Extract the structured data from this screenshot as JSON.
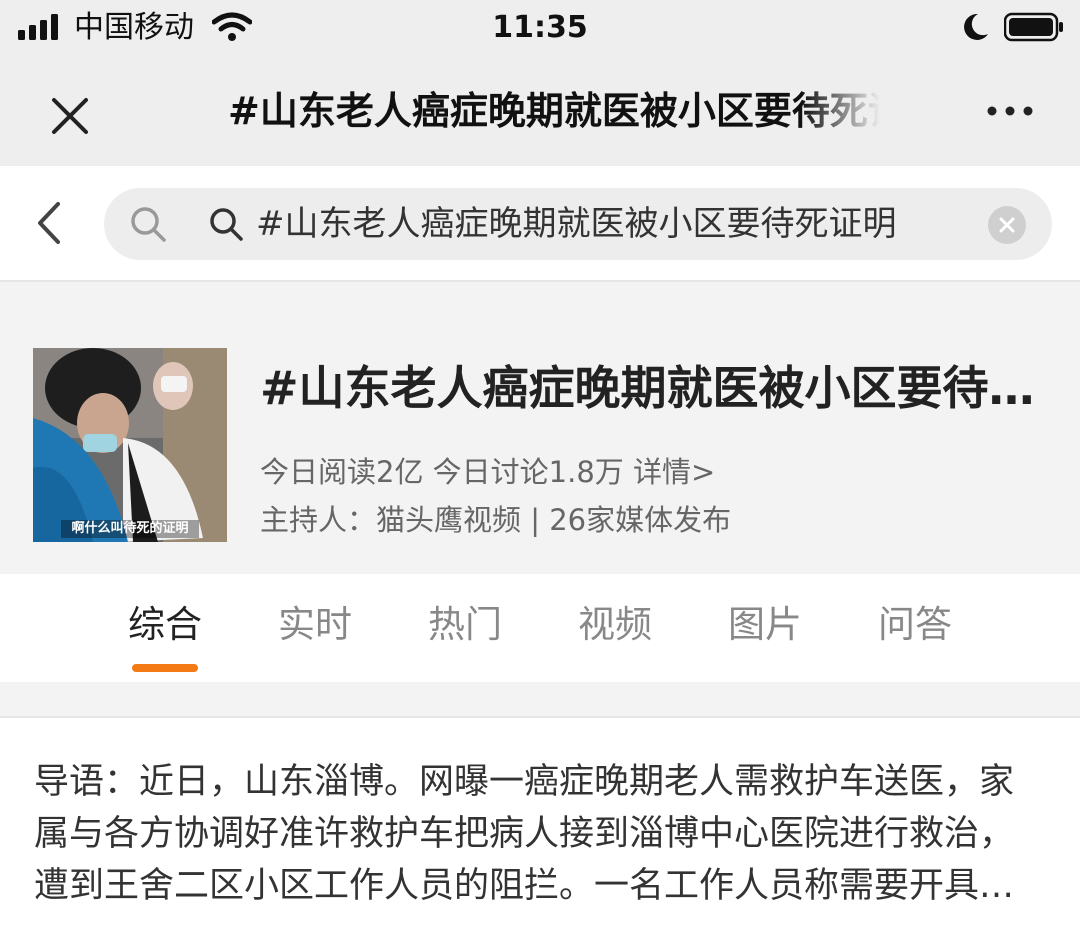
{
  "status_bar": {
    "carrier": "中国移动",
    "time": "11:35"
  },
  "title_bar": {
    "title": "#山东老人癌症晚期就医被小区要待死证明"
  },
  "search": {
    "query": "#山东老人癌症晚期就医被小区要待死证明"
  },
  "topic": {
    "title": "#山东老人癌症晚期就医被小区要待死证明#",
    "thumbnail_caption": "啊什么叫待死的证明",
    "stats": "今日阅读2亿 今日讨论1.8万 详情>",
    "host": "主持人：猫头鹰视频 | 26家媒体发布"
  },
  "tabs": [
    {
      "label": "综合",
      "active": true
    },
    {
      "label": "实时",
      "active": false
    },
    {
      "label": "热门",
      "active": false
    },
    {
      "label": "视频",
      "active": false
    },
    {
      "label": "图片",
      "active": false
    },
    {
      "label": "问答",
      "active": false
    }
  ],
  "intro": {
    "text": "导语：近日，山东淄博。网曝一癌症晚期老人需救护车送医，家属与各方协调好准许救护车把病人接到淄博中心医院进行救治，遭到王舍二区小区工作人员的阻拦。一名工作人员称需要开具待死证明才能放行。"
  },
  "colors": {
    "accent": "#f47a16",
    "header_bg": "#eeeeee",
    "topic_bg": "#f3f3f3"
  },
  "icons": [
    "signal-icon",
    "wifi-icon",
    "moon-icon",
    "battery-icon",
    "close-icon",
    "more-icon",
    "back-icon",
    "search-icon",
    "clear-icon"
  ]
}
